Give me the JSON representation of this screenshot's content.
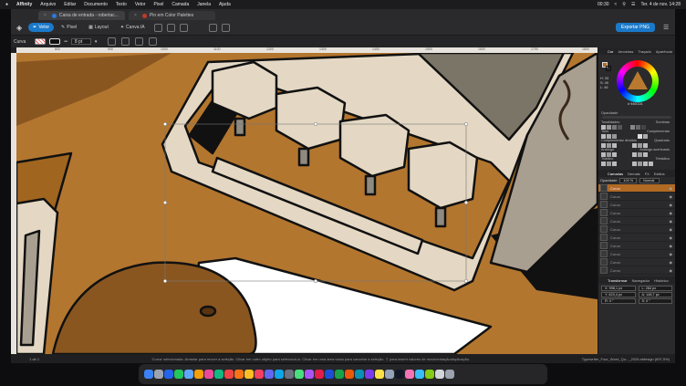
{
  "menubar": {
    "app": "Affinity",
    "items": [
      "Arquivo",
      "Editar",
      "Documento",
      "Texto",
      "Vetor",
      "Pixel",
      "Camada",
      "Janela",
      "Ajuda"
    ],
    "time_small": "00:30",
    "datetime": "Ter. 4 de nov. 14:28"
  },
  "tabs": [
    {
      "label": "Caixa de entrada - robertac..."
    },
    {
      "label": "Pin em Color Palettes"
    }
  ],
  "toolbar": {
    "personas": [
      "Vetor",
      "Pixel",
      "Layout",
      "Canva IA"
    ],
    "export_label": "Exportar PNG"
  },
  "context": {
    "label": "Curva",
    "stroke_value": "8 pt"
  },
  "ruler": {
    "ticks": [
      "800",
      "900",
      "1000",
      "1100",
      "1200",
      "1300",
      "1400",
      "1500",
      "1600",
      "1700",
      "1800",
      "1900"
    ]
  },
  "status": {
    "page": "1 de 1",
    "hint": "'Curva' selecionada. Arrastar para mover a seleção. Clicar em outro objeto para selecioná-lo. Clicar em uma área vazia para cancelar a seleção. ⇧ para inserir valores de movimentação/duplicação.",
    "filename": "Typewriter_Four_Word_Qu..._2025.afdesign (697,5%)"
  },
  "panel": {
    "tabs_top": [
      "Cor",
      "Amostras",
      "Traçado",
      "Aparência"
    ],
    "hsl": {
      "h": "H: 33",
      "s": "S: 45",
      "l": "L: 46"
    },
    "hex": "# 94602A",
    "opacity_label": "Opacidade",
    "harmony": {
      "left": [
        "Tonalidades",
        "Tons",
        "Complementar dividido",
        "Análogo",
        "Triádico"
      ],
      "right": [
        "Sombras",
        "Complementar",
        "Quadrado",
        "Análogo acentuado",
        "Tetrádico"
      ]
    },
    "tabs_mid": [
      "Camadas",
      "Demais",
      "FX",
      "Estilos"
    ],
    "opacity": "100 %",
    "blend": "Normal",
    "layers": [
      "Curva",
      "Curva",
      "Curva",
      "Curva",
      "Curva",
      "Curva",
      "Curva",
      "Curva",
      "Curva",
      "Curva",
      "Curva"
    ],
    "tabs_bottom": [
      "Transformar",
      "Navegador",
      "Histórico"
    ],
    "transform": {
      "x": "X: 998,1 px",
      "y": "Y: 623,4 px",
      "l": "L: 284 px",
      "a": "A: 148,7 px",
      "r": "R: 0 °",
      "s": "S: 0 °"
    }
  },
  "colors": {
    "accent": "#1b79c9",
    "wood": "#b3762f",
    "dark_wood": "#8a5620",
    "cream": "#e4d8c4",
    "outline": "#111111"
  }
}
